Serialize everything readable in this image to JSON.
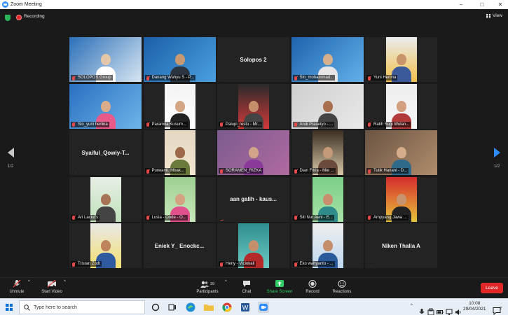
{
  "window": {
    "title": "Zoom Meeting",
    "minimize": "–",
    "maximize": "□",
    "close": "✕"
  },
  "meeting_bar": {
    "recording_label": "Recording",
    "view_label": "View"
  },
  "pagination": {
    "left": "1/2",
    "right": "1/2"
  },
  "tiles": [
    {
      "name": "SOLOPOS Group",
      "video": true,
      "active": true
    },
    {
      "name": "Danang Wahyu S - P...",
      "video": true
    },
    {
      "name": "Solopos 2",
      "video": false
    },
    {
      "name": "Slo_mohammad...",
      "video": true
    },
    {
      "name": "Yuni Herlina",
      "video": true
    },
    {
      "name": "Slo_yuni herlina",
      "video": true
    },
    {
      "name": "Paramita Kusum...",
      "video": true
    },
    {
      "name": "Palupi_restu - Mr...",
      "video": true
    },
    {
      "name": "Andi Prasetyo - ...",
      "video": true
    },
    {
      "name": "Ratih Sugi Wulan...",
      "video": true
    },
    {
      "name": "Syaiful_Qowiy-T...",
      "video": false
    },
    {
      "name": "Purwanti. Mbak...",
      "video": true
    },
    {
      "name": "SORAMEN_RIZKA",
      "video": true
    },
    {
      "name": "Dian Fitria - Mie ...",
      "video": true
    },
    {
      "name": "Tutik Hariani - D...",
      "video": true
    },
    {
      "name": "Ari Lackd's",
      "video": true
    },
    {
      "name": "Lusia - Onde - O...",
      "video": true
    },
    {
      "name": "aan galih - kaus...",
      "video": false
    },
    {
      "name": "Siti Nur Aeni - E...",
      "video": true
    },
    {
      "name": "Ampyang Jawa ...",
      "video": true
    },
    {
      "name": "Tristan Zodt",
      "video": true
    },
    {
      "name": "Eniek Y_ Enockc...",
      "video": false
    },
    {
      "name": "Heny - Viciokali",
      "video": true
    },
    {
      "name": "Eko wahyanto - ...",
      "video": true
    },
    {
      "name": "Niken Thalia A",
      "video": false
    }
  ],
  "toolbar": {
    "unmute": "Unmute",
    "start_video": "Start Video",
    "participants": "Participants",
    "participants_count": "39",
    "chat": "Chat",
    "share_screen": "Share Screen",
    "record": "Record",
    "reactions": "Reactions",
    "leave": "Leave"
  },
  "taskbar": {
    "search_placeholder": "Type here to search",
    "time": "10:08",
    "date": "29/04/2021",
    "notification_count": "2"
  },
  "colors": {
    "accent": "#2d8cff",
    "share_green": "#33cc66",
    "leave_red": "#e02828",
    "active_speaker": "#d7e04a"
  }
}
